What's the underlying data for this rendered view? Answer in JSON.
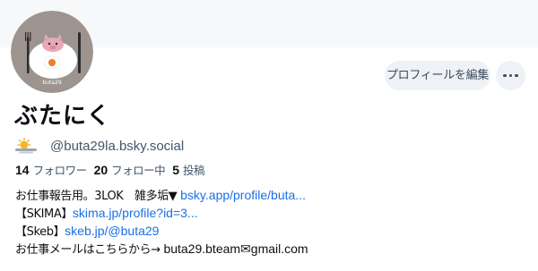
{
  "profile": {
    "display_name": "ぶたにく",
    "handle": "@buta29la.bsky.social",
    "status_icon": "sun-behind-cloud-icon",
    "avatar_label": "buta29"
  },
  "actions": {
    "edit_profile": "プロフィールを編集",
    "more_icon": "ellipsis-icon"
  },
  "stats": {
    "followers": {
      "count": "14",
      "label": "フォロワー"
    },
    "following": {
      "count": "20",
      "label": "フォロー中"
    },
    "posts": {
      "count": "5",
      "label": "投稿"
    }
  },
  "bio": {
    "line1_text": "お仕事報告用。3LOK　雑多垢▼ ",
    "line1_link": "bsky.app/profile/buta...",
    "line2_prefix": "【SKIMA】",
    "line2_link": "skima.jp/profile?id=3...",
    "line3_prefix": "【Skeb】",
    "line3_link": "skeb.jp/@buta29",
    "line4_text": "お仕事メールはこちらから→ ",
    "line4_email": "buta29.bteam✉gmail.com"
  },
  "colors": {
    "link": "#1a6fe6",
    "muted": "#42576c",
    "button_bg": "#eef1f5",
    "avatar_bg": "#9e948f"
  }
}
